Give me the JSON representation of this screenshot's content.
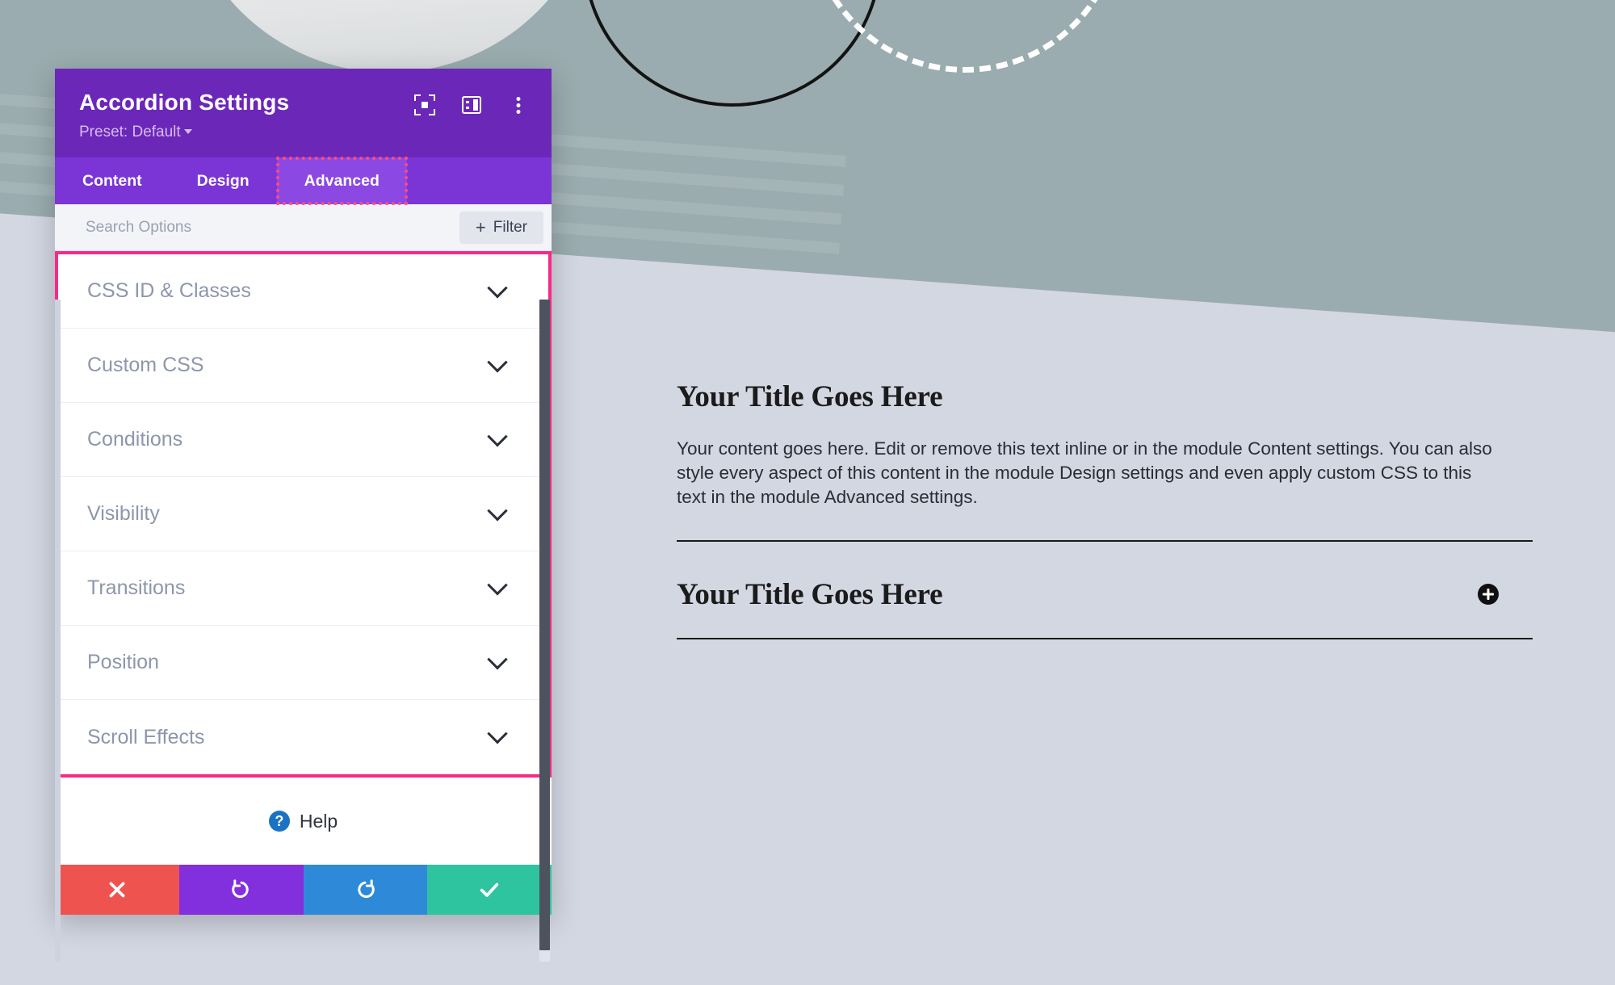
{
  "modal": {
    "title": "Accordion Settings",
    "preset_label": "Preset: Default",
    "header_icons": [
      {
        "name": "expand-view-icon"
      },
      {
        "name": "layout-panel-icon"
      },
      {
        "name": "more-options-icon"
      }
    ],
    "tabs": [
      {
        "label": "Content",
        "active": false
      },
      {
        "label": "Design",
        "active": false
      },
      {
        "label": "Advanced",
        "active": true
      }
    ],
    "search": {
      "placeholder": "Search Options",
      "value": "",
      "filter_label": "Filter",
      "filter_plus": "+"
    },
    "options": [
      {
        "label": "CSS ID & Classes"
      },
      {
        "label": "Custom CSS"
      },
      {
        "label": "Conditions"
      },
      {
        "label": "Visibility"
      },
      {
        "label": "Transitions"
      },
      {
        "label": "Position"
      },
      {
        "label": "Scroll Effects"
      }
    ],
    "help": {
      "icon_glyph": "?",
      "label": "Help"
    },
    "footer_buttons": [
      {
        "name": "cancel-button",
        "icon": "close-icon",
        "color": "#ef5350"
      },
      {
        "name": "undo-button",
        "icon": "undo-icon",
        "color": "#8230dd"
      },
      {
        "name": "redo-button",
        "icon": "redo-icon",
        "color": "#2e8ad8"
      },
      {
        "name": "save-button",
        "icon": "check-icon",
        "color": "#2fc4a0"
      }
    ],
    "highlight_colors": {
      "options_box": "#f72a87",
      "active_tab_outline": "#fb4c7d"
    },
    "theme_colors": {
      "header_purple": "#6b27b8",
      "tab_bar_purple": "#7b34d6",
      "active_tab_purple": "#8c48e2"
    }
  },
  "preview": {
    "item1": {
      "title": "Your Title Goes Here",
      "body": "Your content goes here. Edit or remove this text inline or in the module Content settings. You can also style every aspect of this content in the module Design settings and even apply custom CSS to this text in the module Advanced settings."
    },
    "item2": {
      "title": "Your Title Goes Here",
      "toggle_icon": "plus-icon"
    }
  },
  "background": {
    "page_color": "#d3d7e2",
    "band_color": "#9aacaf",
    "decor": [
      "photo-circle-chess",
      "black-outline-circle",
      "white-dashed-circle"
    ]
  }
}
